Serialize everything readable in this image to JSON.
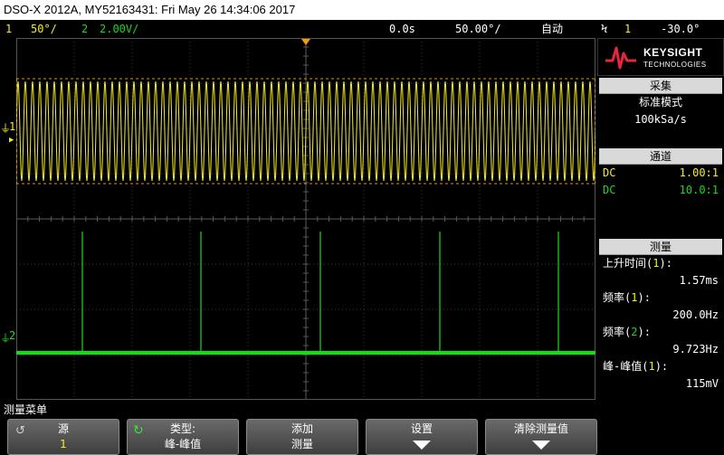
{
  "title": "DSO-X 2012A, MY52163431: Fri May 26 14:34:06 2017",
  "status": {
    "ch1_num": "1",
    "ch1_scale": "50°/",
    "ch2_num": "2",
    "ch2_scale": "2.00V/",
    "time_delay": "0.0s",
    "time_scale": "50.00°/",
    "trigger_mode": "自动",
    "trigger_icon": "Ϟ",
    "trigger_source": "1",
    "trigger_level": "-30.0°"
  },
  "screen_markers": {
    "ch1_label": "1",
    "ch2_label": "2"
  },
  "panel": {
    "brand_top": "KEYSIGHT",
    "brand_bottom": "TECHNOLOGIES",
    "acquire": {
      "header": "采集",
      "mode": "标准模式",
      "rate": "100kSa/s"
    },
    "channels": {
      "header": "通道",
      "rows": [
        {
          "coupling": "DC",
          "probe": "1.00:1"
        },
        {
          "coupling": "DC",
          "probe": "10.0:1"
        }
      ]
    },
    "measure": {
      "header": "测量",
      "items": [
        {
          "name": "上升时间",
          "src": "1",
          "value": "1.57ms"
        },
        {
          "name": "频率",
          "src": "1",
          "value": "200.0Hz"
        },
        {
          "name": "频率",
          "src": "2",
          "value": "9.723Hz"
        },
        {
          "name": "峰-峰值",
          "src": "1",
          "value": "115mV"
        }
      ]
    }
  },
  "menu": {
    "title": "测量菜单",
    "keys": [
      {
        "top": "源",
        "bottom": "1"
      },
      {
        "top": "类型:",
        "bottom": "峰-峰值"
      },
      {
        "top": "添加",
        "bottom": "测量"
      },
      {
        "top": "设置",
        "bottom": ""
      },
      {
        "top": "清除测量值",
        "bottom": ""
      }
    ]
  },
  "colors": {
    "ch1": "#f2ee27",
    "ch2": "#1fd620",
    "trigger_marker": "#f39c12",
    "cursor_dash": "#e08a1e"
  }
}
